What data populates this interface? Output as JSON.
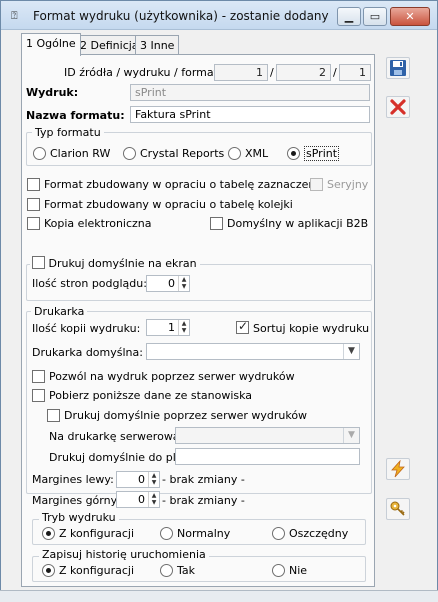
{
  "window": {
    "title": "Format wydruku (użytkownika) - zostanie dodany",
    "icon": "document-icon",
    "minimize": "▁",
    "maximize": "▭",
    "close": "✕"
  },
  "tabs": [
    {
      "label": "1 Ogólne"
    },
    {
      "label": "2 Definicja"
    },
    {
      "label": "3 Inne"
    }
  ],
  "ids": {
    "label": "ID źródła / wydruku / formatu:",
    "source": "1",
    "print": "2",
    "format": "1",
    "sep": "/"
  },
  "wydruk": {
    "label": "Wydruk:",
    "value": "sPrint"
  },
  "nazwa": {
    "label": "Nazwa formatu:",
    "value": "Faktura sPrint"
  },
  "typ": {
    "legend": "Typ formatu",
    "options": [
      "Clarion RW",
      "Crystal Reports",
      "XML",
      "sPrint"
    ],
    "selected": "sPrint"
  },
  "checks": {
    "zaznaczen": "Format zbudowany w opraciu o tabelę zaznaczeń",
    "seryjny": "Seryjny",
    "kolejki": "Format zbudowany w opraciu o tabelę kolejki",
    "kopia": "Kopia elektroniczna",
    "b2b": "Domyślny w aplikacji B2B"
  },
  "ekran": {
    "label": "Drukuj domyślnie na ekran",
    "pages_label": "Ilość stron podglądu:",
    "pages": "0"
  },
  "drukarka": {
    "legend": "Drukarka",
    "copies_label": "Ilość kopii wydruku:",
    "copies": "1",
    "sort_label": "Sortuj kopie wydruku",
    "default_label": "Drukarka domyślna:",
    "default_value": "",
    "allow_server": "Pozwól na wydruk poprzez serwer wydruków",
    "fetch_station": "Pobierz poniższe dane ze stanowiska",
    "print_server": "Drukuj domyślnie poprzez serwer wydruków",
    "server_printer_label": "Na drukarkę serwerową:",
    "server_printer_value": "",
    "file_label": "Drukuj domyślnie do pliku:",
    "file_value": ""
  },
  "margins": {
    "left_label": "Margines lewy:",
    "left_value": "0",
    "left_note": "- brak zmiany -",
    "top_label": "Margines górny:",
    "top_value": "0",
    "top_note": "- brak zmiany -"
  },
  "tryb": {
    "legend": "Tryb wydruku",
    "options": [
      "Z konfiguracji",
      "Normalny",
      "Oszczędny"
    ],
    "selected": "Z konfiguracji"
  },
  "historia": {
    "legend": "Zapisuj historię uruchomienia",
    "options": [
      "Z konfiguracji",
      "Tak",
      "Nie"
    ],
    "selected": "Z konfiguracji"
  },
  "side": {
    "save": "save-icon",
    "cancel": "cancel-icon",
    "run": "lightning-icon",
    "key": "key-icon"
  },
  "colors": {
    "accent": "#3a6ea5",
    "cancel": "#d6302a",
    "lightning": "#e8a317"
  }
}
